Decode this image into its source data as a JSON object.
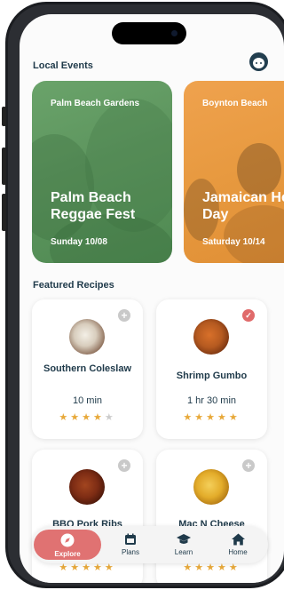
{
  "header": {
    "local_events_title": "Local Events",
    "featured_recipes_title": "Featured Recipes"
  },
  "events": [
    {
      "city": "Palm Beach Gardens",
      "name": "Palm Beach Reggae Fest",
      "date": "Sunday 10/08",
      "color": "#5e975f"
    },
    {
      "city": "Boynton Beach",
      "name": "Jamaican Heroes Day",
      "date": "Saturday 10/14",
      "color": "#e8993f"
    }
  ],
  "recipes": [
    {
      "name": "Southern Coleslaw",
      "time": "10 min",
      "rating": 4,
      "favorite": false
    },
    {
      "name": "Shrimp Gumbo",
      "time": "1 hr 30 min",
      "rating": 5,
      "favorite": true
    },
    {
      "name": "BBQ Pork Ribs",
      "time": "",
      "rating": 5,
      "favorite": false
    },
    {
      "name": "Mac N Cheese",
      "time": "",
      "rating": 5,
      "favorite": false
    }
  ],
  "tabs": [
    {
      "label": "Explore",
      "icon": "compass-icon",
      "active": true
    },
    {
      "label": "Plans",
      "icon": "calendar-icon",
      "active": false
    },
    {
      "label": "Learn",
      "icon": "graduation-cap-icon",
      "active": false
    },
    {
      "label": "Home",
      "icon": "home-icon",
      "active": false
    }
  ],
  "colors": {
    "accent": "#e07272",
    "navy": "#1f3a4a",
    "star": "#e8a93a"
  }
}
